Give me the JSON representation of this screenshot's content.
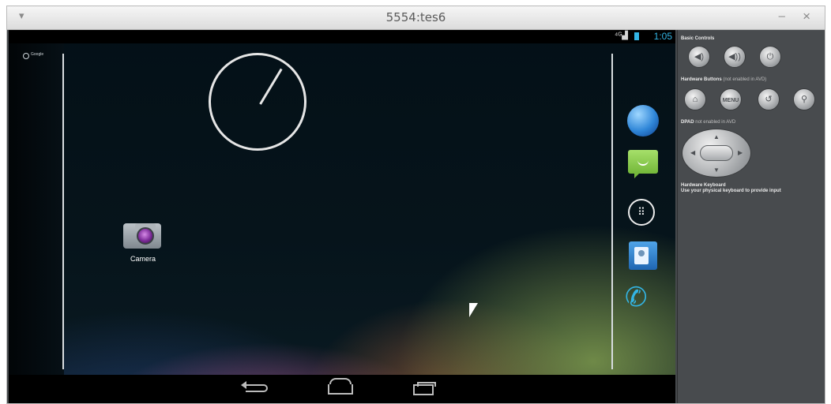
{
  "window": {
    "title": "5554:tes6",
    "menu_glyph": "▾",
    "minimize_glyph": "–",
    "close_glyph": "×"
  },
  "status_bar": {
    "signal_glyph": "⁴ᴳ▟",
    "time": "1:05"
  },
  "home_screen": {
    "search_label": "Google",
    "apps": [
      {
        "label": "Camera",
        "icon": "camera-icon"
      }
    ],
    "dock": [
      {
        "icon": "browser-icon"
      },
      {
        "icon": "messaging-icon"
      },
      {
        "icon": "all-apps-icon",
        "glyph": "⠿"
      },
      {
        "icon": "people-icon"
      },
      {
        "icon": "phone-icon",
        "glyph": "✆"
      }
    ]
  },
  "nav_bar": {
    "buttons": [
      "back-icon",
      "home-icon",
      "recent-apps-icon"
    ]
  },
  "controls": {
    "basic_controls_title": "Basic Controls",
    "volume_down_glyph": "◀)",
    "volume_up_glyph": "◀))",
    "power_glyph": "⏻",
    "hardware_buttons_title": "Hardware Buttons",
    "hardware_buttons_note": "(not enabled in AVD)",
    "home_glyph": "⌂",
    "menu_label": "MENU",
    "back_glyph": "↺",
    "search_glyph": "⚲",
    "dpad_title": "DPAD",
    "dpad_note": "not enabled in AVD",
    "keyboard_title": "Hardware Keyboard",
    "keyboard_note": "Use your physical keyboard to provide input"
  },
  "colors": {
    "accent": "#33b5e5",
    "messaging_green": "#8dd152",
    "controls_panel": "#484b4e"
  }
}
